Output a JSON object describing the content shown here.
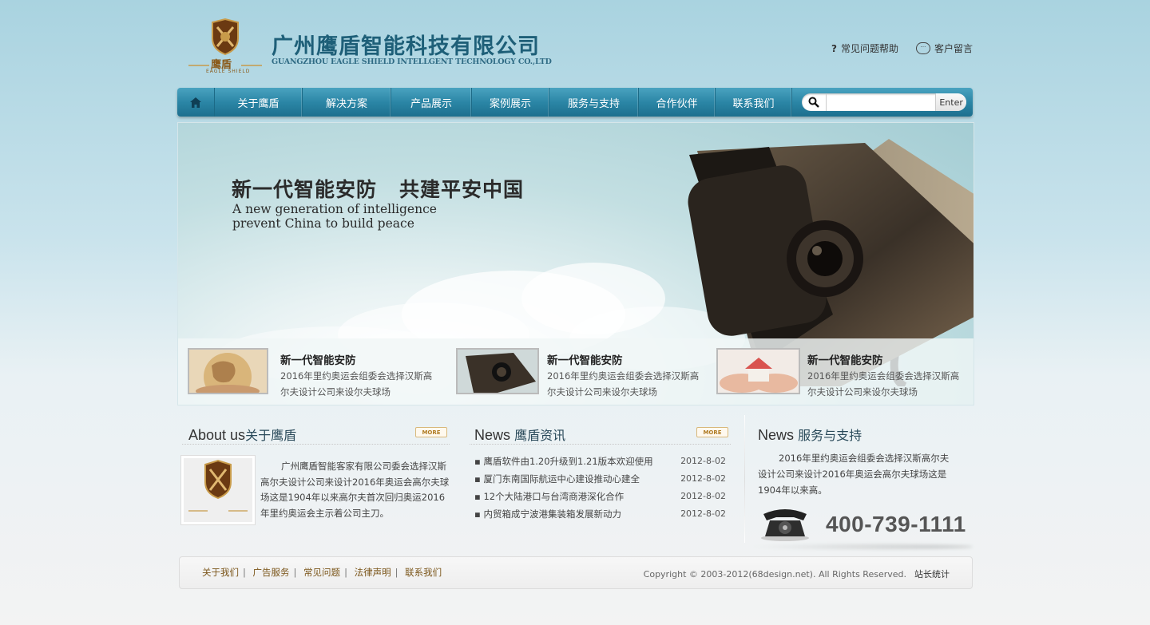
{
  "header": {
    "company_cn": "广州鹰盾智能科技有限公司",
    "company_en": "GUANGZHOU EAGLE SHIELD INTELLGENT TECHNOLOGY CO.,LTD",
    "logo_text": "鹰盾",
    "logo_subtext": "EAGLE SHIELD",
    "links": [
      {
        "icon": "question-icon",
        "label": "常见问题帮助"
      },
      {
        "icon": "chat-bubble-icon",
        "label": "客户留言"
      }
    ]
  },
  "nav": {
    "home_icon": "home-icon",
    "items": [
      "关于鹰盾",
      "解决方案",
      "产品展示",
      "案例展示",
      "服务与支持",
      "合作伙伴",
      "联系我们"
    ],
    "search_placeholder": "",
    "search_button": "Enter"
  },
  "banner": {
    "title_cn_1": "新一代智能安防",
    "title_cn_2": "共建平安中国",
    "title_en_1": "A new generation of intelligence",
    "title_en_2": "prevent China to build peace",
    "thumbs": [
      {
        "image": "globe-hands",
        "title": "新一代智能安防",
        "desc": "2016年里约奥运会组委会选择汉斯高尔夫设计公司来设尔夫球场"
      },
      {
        "image": "security-camera",
        "title": "新一代智能安防",
        "desc": "2016年里约奥运会组委会选择汉斯高尔夫设计公司来设尔夫球场"
      },
      {
        "image": "house-hands",
        "title": "新一代智能安防",
        "desc": "2016年里约奥运会组委会选择汉斯高尔夫设计公司来设尔夫球场"
      }
    ]
  },
  "about": {
    "title_en": "About us",
    "title_cn": "关于鹰盾",
    "more": "MORE",
    "text": "广州鹰盾智能客家有限公司委会选择汉斯高尔夫设计公司来设计2016年奥运会高尔夫球场这是1904年以来高尔夫首次回归奥运2016年里约奥运会主示着公司主刀。"
  },
  "news": {
    "title_en": "News",
    "title_cn": "鹰盾资讯",
    "more": "MORE",
    "items": [
      {
        "title": "鹰盾软件由1.20升级到1.21版本欢迎使用",
        "date": "2012-8-02"
      },
      {
        "title": "厦门东南国际航运中心建设推动心建全",
        "date": "2012-8-02"
      },
      {
        "title": "12个大陆港口与台湾商港深化合作",
        "date": "2012-8-02"
      },
      {
        "title": "内贸箱成宁波港集装箱发展新动力",
        "date": "2012-8-02"
      }
    ]
  },
  "service": {
    "title_en": "News",
    "title_cn": "服务与支持",
    "text": "2016年里约奥运会组委会选择汉斯高尔夫设计公司来设计2016年奥运会高尔夫球场这是1904年以来高。",
    "phone": "400-739-1111"
  },
  "footer": {
    "links": [
      "关于我们",
      "广告服务",
      "常见问题",
      "法律声明",
      "联系我们"
    ],
    "copyright": "Copyright © 2003-2012(68design.net). All Rights Reserved.",
    "stat": "站长统计"
  },
  "colors": {
    "nav_bg": "#2b86a6",
    "company_text": "#1e5f78",
    "footer_link": "#7a5418"
  }
}
